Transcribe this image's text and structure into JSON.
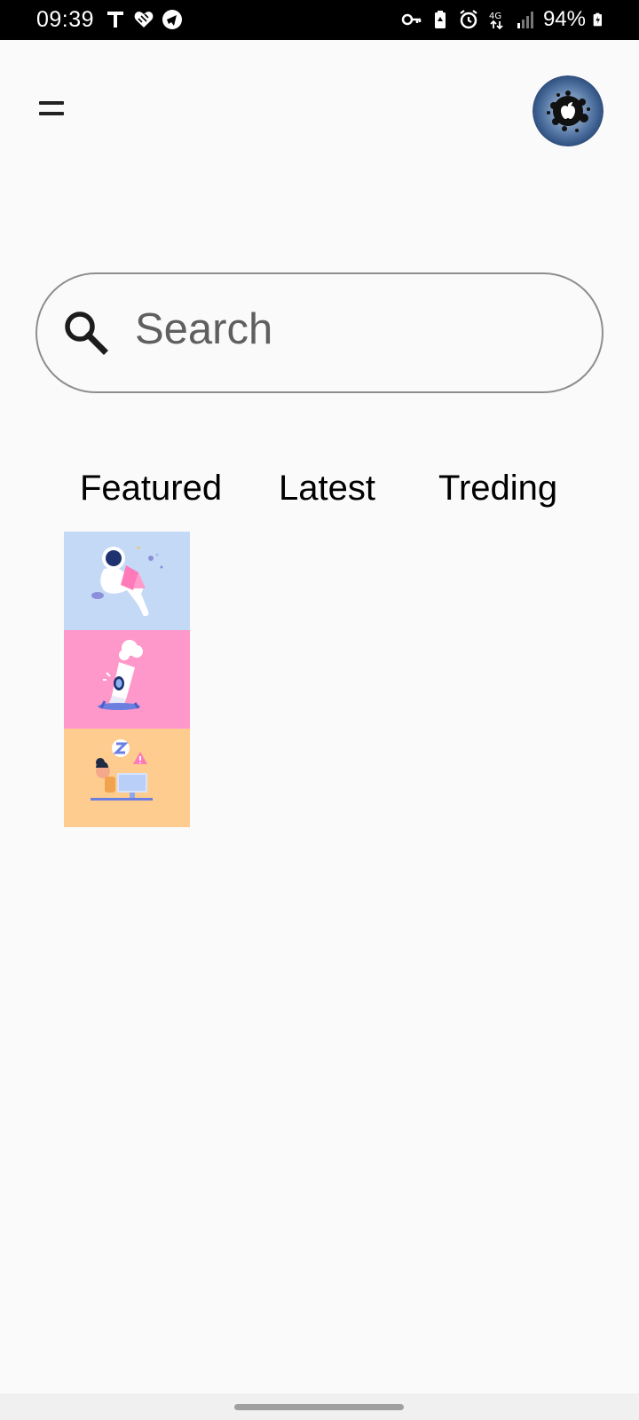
{
  "status_bar": {
    "time": "09:39",
    "battery_percent": "94%",
    "left_icons": [
      "t-icon",
      "heart-icon",
      "telegram-icon"
    ],
    "right_icons": [
      "key-icon",
      "battery-saver-icon",
      "alarm-icon",
      "network-4g-icon",
      "signal-icon",
      "battery-charging-icon"
    ]
  },
  "header": {
    "menu_icon": "menu-icon",
    "avatar": "profile-avatar"
  },
  "search": {
    "placeholder": "Search",
    "value": ""
  },
  "tabs": [
    {
      "label": "Featured"
    },
    {
      "label": "Latest"
    },
    {
      "label": "Treding"
    }
  ],
  "cards": [
    {
      "illustration": "astronaut-reading-illustration",
      "bg": "#c4d9f6"
    },
    {
      "illustration": "rocket-launch-illustration",
      "bg": "#ff98ca"
    },
    {
      "illustration": "sleeping-at-computer-illustration",
      "bg": "#ffcc8f"
    }
  ]
}
